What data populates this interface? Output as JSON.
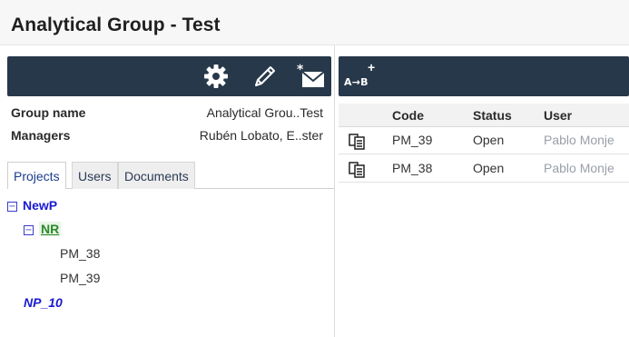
{
  "title": "Analytical Group - Test",
  "left_toolbar": {
    "icons": [
      "gear-icon",
      "pencil-icon",
      "mail-icon"
    ]
  },
  "info": {
    "group_name_label": "Group name",
    "group_name_value": "Analytical Grou..Test",
    "managers_label": "Managers",
    "managers_value": "Rubén Lobato, E..ster"
  },
  "tabs": [
    {
      "label": "Projects",
      "active": true
    },
    {
      "label": "Users",
      "active": false
    },
    {
      "label": "Documents",
      "active": false
    }
  ],
  "tree": {
    "root": "NewP",
    "child": "NR",
    "leaves": [
      "PM_38",
      "PM_39"
    ],
    "sibling": "NP_10",
    "toggle_symbol": "⊟"
  },
  "right_toolbar": {
    "plus": "+",
    "label": "A→B"
  },
  "grid": {
    "columns": [
      "Code",
      "Status",
      "User"
    ],
    "rows": [
      {
        "code": "PM_39",
        "status": "Open",
        "user": "Pablo Monje"
      },
      {
        "code": "PM_38",
        "status": "Open",
        "user": "Pablo Monje"
      }
    ]
  }
}
